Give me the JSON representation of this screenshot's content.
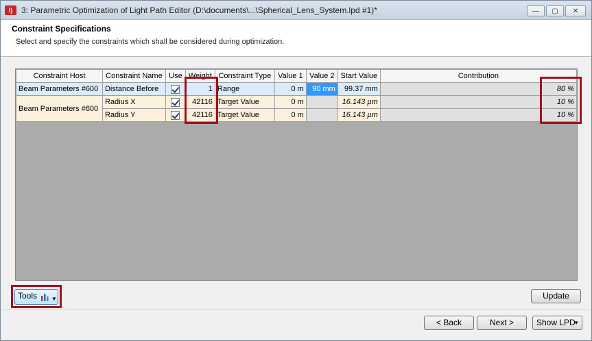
{
  "window": {
    "title": "3: Parametric Optimization of Light Path Editor (D:\\documents\\...\\Spherical_Lens_System.lpd #1)*",
    "app_icon": "I)"
  },
  "header": {
    "title": "Constraint Specifications",
    "subtitle": "Select and specify the constraints which shall be considered during optimization."
  },
  "table": {
    "columns": [
      "Constraint Host",
      "Constraint Name",
      "Use",
      "Weight",
      "Constraint Type",
      "Value 1",
      "Value 2",
      "Start Value",
      "Contribution"
    ],
    "rows": [
      {
        "host": "Beam Parameters #600",
        "name": "Distance Before",
        "use": true,
        "weight": "1",
        "type": "Range",
        "value1": "0 m",
        "value2": "90 mm",
        "start": "99.37 mm",
        "contribution": "80 %"
      },
      {
        "host": "Beam Parameters #600",
        "name": "Radius X",
        "use": true,
        "weight": "42116",
        "type": "Target Value",
        "value1": "0 m",
        "value2": "",
        "start": "16.143 µm",
        "contribution": "10 %"
      },
      {
        "host": "",
        "name": "Radius Y",
        "use": true,
        "weight": "42116",
        "type": "Target Value",
        "value1": "0 m",
        "value2": "",
        "start": "16.143 µm",
        "contribution": "10 %"
      }
    ]
  },
  "buttons": {
    "tools": "Tools",
    "update": "Update",
    "back": "< Back",
    "next": "Next >",
    "show_lpd": "Show  LPD"
  },
  "colors": {
    "highlight": "#a50f1a",
    "selection": "#3399ff"
  }
}
